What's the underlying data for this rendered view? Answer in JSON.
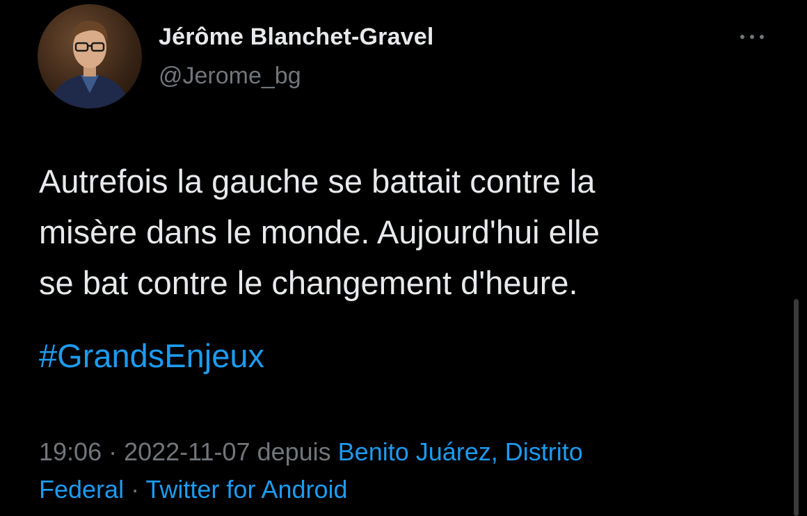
{
  "author": {
    "name": "Jérôme Blanchet-Gravel",
    "handle": "@Jerome_bg",
    "avatar_icon": "avatar-photo"
  },
  "more_icon": "more-horizontal-icon",
  "tweet": {
    "lines": [
      "Autrefois la gauche se battait contre la",
      "misère dans le monde. Aujourd'hui elle",
      "se bat contre le changement d'heure."
    ],
    "hashtag": "#GrandsEnjeux"
  },
  "meta": {
    "time": "19:06",
    "separator": " · ",
    "date": "2022-11-07",
    "depuis": " depuis ",
    "location_part1": "Benito Juárez, Distrito",
    "location_part2": "Federal",
    "source": "Twitter for Android"
  },
  "colors": {
    "background": "#000000",
    "text": "#e7e9ea",
    "secondary": "#71767b",
    "accent": "#1d9bf0"
  }
}
